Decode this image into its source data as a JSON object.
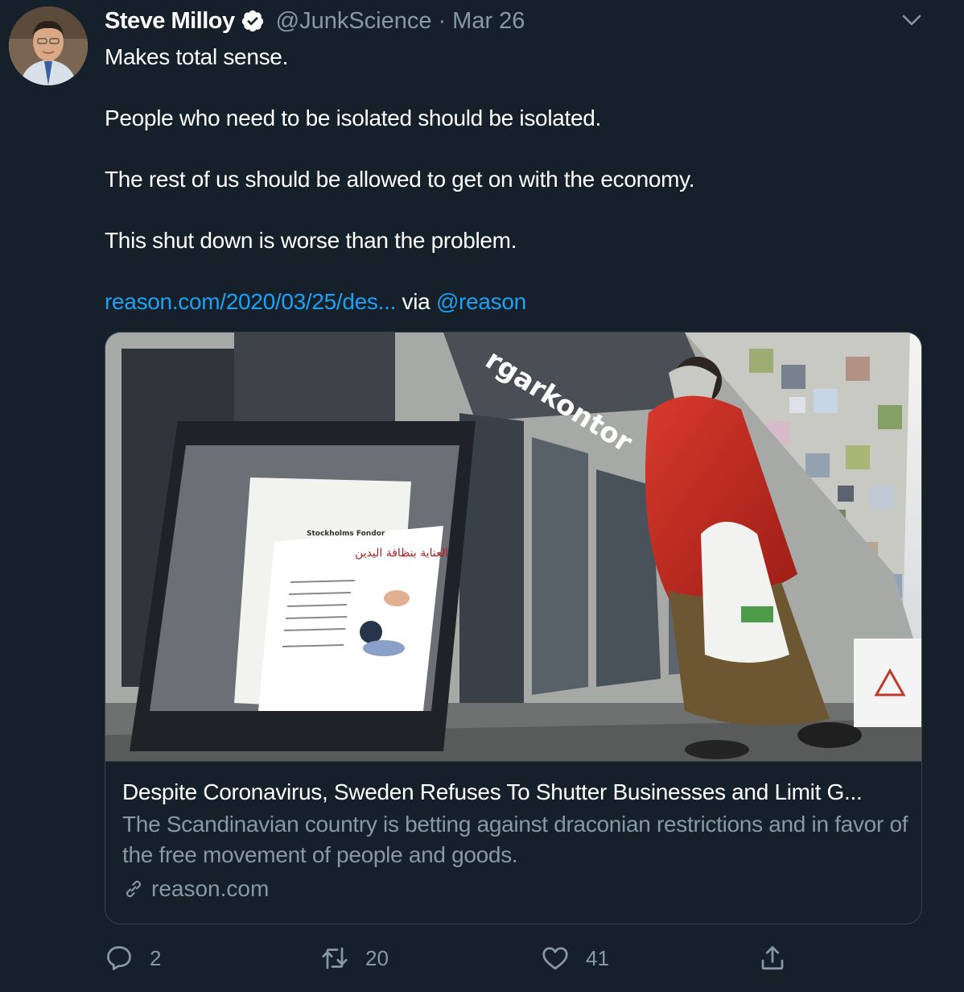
{
  "author": {
    "name": "Steve Milloy",
    "handle": "@JunkScience",
    "separator": "·",
    "date": "Mar 26"
  },
  "tweet": {
    "line1": "Makes total sense.",
    "line2": "People who need to be isolated should be isolated.",
    "line3": "The rest of us should be allowed to get on with the economy.",
    "line4": "This shut down is worse than the problem.",
    "link_text": "reason.com/2020/03/25/des...",
    "via_text": " via ",
    "mention": "@reason"
  },
  "card": {
    "title": "Despite Coronavirus, Sweden Refuses To Shutter Businesses and Limit G...",
    "description": "The Scandinavian country is betting against draconian restrictions and in favor of the free movement of people and goods.",
    "domain": "reason.com",
    "sign_text": "rgarkontor",
    "poster_title": "Stockholms Fondor",
    "poster_arabic": "العناية بنظافة اليدين"
  },
  "actions": {
    "replies": "2",
    "retweets": "20",
    "likes": "41"
  },
  "icons": [
    "avatar",
    "verified-icon",
    "chevron-down-icon",
    "link-icon",
    "reply-icon",
    "retweet-icon",
    "like-icon",
    "share-icon"
  ],
  "colors": {
    "background": "#15202b",
    "link": "#1da1f2",
    "muted": "#8899a6",
    "border": "#38444d"
  }
}
